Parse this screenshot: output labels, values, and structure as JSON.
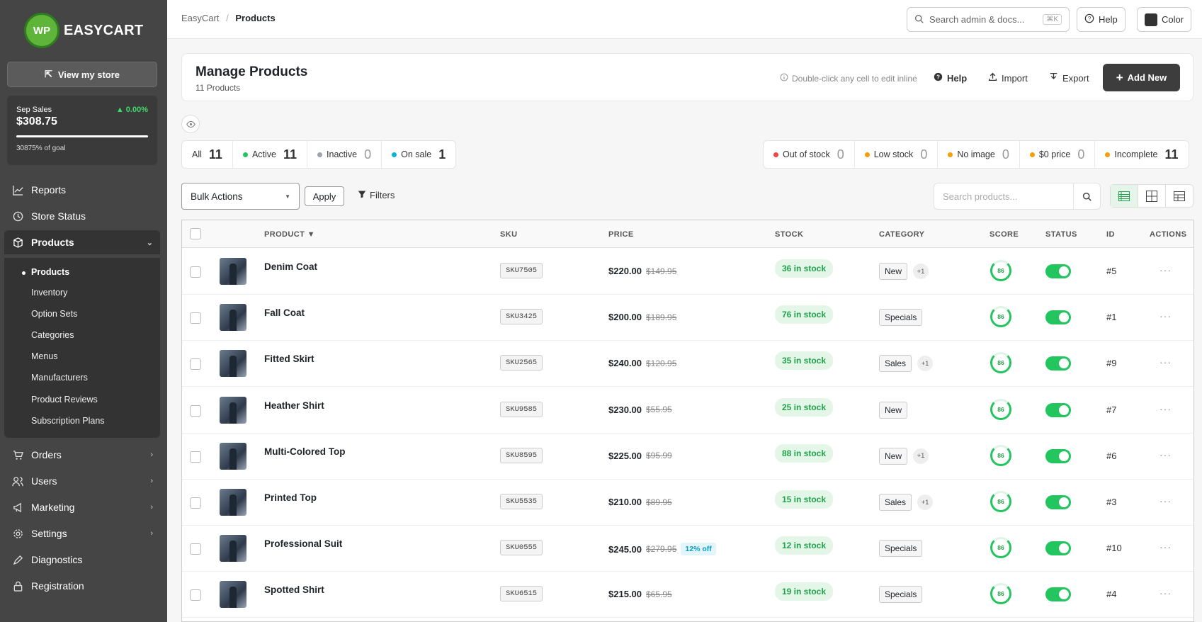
{
  "app": {
    "logo_mark": "WP",
    "logo_text": "EASYCART",
    "view_store": "View my store"
  },
  "sales": {
    "label": "Sep Sales",
    "change": "▲ 0.00%",
    "amount": "$308.75",
    "goal": "30875% of goal",
    "goal_progress": 1.0
  },
  "nav": {
    "reports": "Reports",
    "store_status": "Store Status",
    "products": "Products",
    "orders": "Orders",
    "users": "Users",
    "marketing": "Marketing",
    "settings": "Settings",
    "diagnostics": "Diagnostics",
    "registration": "Registration"
  },
  "subnav": [
    "Products",
    "Inventory",
    "Option Sets",
    "Categories",
    "Menus",
    "Manufacturers",
    "Product Reviews",
    "Subscription Plans"
  ],
  "topbar": {
    "crumb_root": "EasyCart",
    "crumb_sep": "/",
    "crumb_current": "Products",
    "search_placeholder": "Search admin & docs...",
    "search_kbd": "⌘K",
    "help": "Help",
    "color": "Color"
  },
  "header": {
    "title": "Manage Products",
    "subtitle": "11 Products",
    "hint": "Double-click any cell to edit inline",
    "help": "Help",
    "import": "Import",
    "export": "Export",
    "add_new": "Add New"
  },
  "filters_left": [
    {
      "label": "All",
      "count": "11",
      "dot": ""
    },
    {
      "label": "Active",
      "count": "11",
      "dot": "#22c55e"
    },
    {
      "label": "Inactive",
      "count": "0",
      "dot": "#9ca3af"
    },
    {
      "label": "On sale",
      "count": "1",
      "dot": "#06b6d4"
    }
  ],
  "filters_right": [
    {
      "label": "Out of stock",
      "count": "0",
      "dot": "#ef4444"
    },
    {
      "label": "Low stock",
      "count": "0",
      "dot": "#f59e0b"
    },
    {
      "label": "No image",
      "count": "0",
      "dot": "#f59e0b"
    },
    {
      "label": "$0 price",
      "count": "0",
      "dot": "#f59e0b"
    },
    {
      "label": "Incomplete",
      "count": "11",
      "dot": "#f59e0b"
    }
  ],
  "toolbar": {
    "bulk": "Bulk Actions",
    "apply": "Apply",
    "filters": "Filters",
    "search_placeholder": "Search products..."
  },
  "columns": {
    "product": "PRODUCT ▼",
    "sku": "SKU",
    "price": "PRICE",
    "stock": "STOCK",
    "category": "CATEGORY",
    "score": "SCORE",
    "status": "STATUS",
    "id": "ID",
    "actions": "ACTIONS"
  },
  "products": [
    {
      "name": "Denim Coat",
      "sku": "SKU7505",
      "price": "$220.00",
      "old": "$149.95",
      "off": "",
      "stock": "36 in stock",
      "cat": "New",
      "more": "+1",
      "score": "86",
      "id": "#5"
    },
    {
      "name": "Fall Coat",
      "sku": "SKU3425",
      "price": "$200.00",
      "old": "$189.95",
      "off": "",
      "stock": "76 in stock",
      "cat": "Specials",
      "more": "",
      "score": "86",
      "id": "#1"
    },
    {
      "name": "Fitted Skirt",
      "sku": "SKU2565",
      "price": "$240.00",
      "old": "$120.95",
      "off": "",
      "stock": "35 in stock",
      "cat": "Sales",
      "more": "+1",
      "score": "86",
      "id": "#9"
    },
    {
      "name": "Heather Shirt",
      "sku": "SKU9585",
      "price": "$230.00",
      "old": "$55.95",
      "off": "",
      "stock": "25 in stock",
      "cat": "New",
      "more": "",
      "score": "86",
      "id": "#7"
    },
    {
      "name": "Multi-Colored Top",
      "sku": "SKU8595",
      "price": "$225.00",
      "old": "$95.99",
      "off": "",
      "stock": "88 in stock",
      "cat": "New",
      "more": "+1",
      "score": "86",
      "id": "#6"
    },
    {
      "name": "Printed Top",
      "sku": "SKU5535",
      "price": "$210.00",
      "old": "$89.95",
      "off": "",
      "stock": "15 in stock",
      "cat": "Sales",
      "more": "+1",
      "score": "86",
      "id": "#3"
    },
    {
      "name": "Professional Suit",
      "sku": "SKU0555",
      "price": "$245.00",
      "old": "$279.95",
      "off": "12% off",
      "stock": "12 in stock",
      "cat": "Specials",
      "more": "",
      "score": "86",
      "id": "#10"
    },
    {
      "name": "Spotted Shirt",
      "sku": "SKU6515",
      "price": "$215.00",
      "old": "$65.95",
      "off": "",
      "stock": "19 in stock",
      "cat": "Specials",
      "more": "",
      "score": "86",
      "id": "#4"
    }
  ],
  "colors": {
    "sidebar": "#454545",
    "accent_green": "#22c55e",
    "primary_button": "#3d3d3d"
  }
}
